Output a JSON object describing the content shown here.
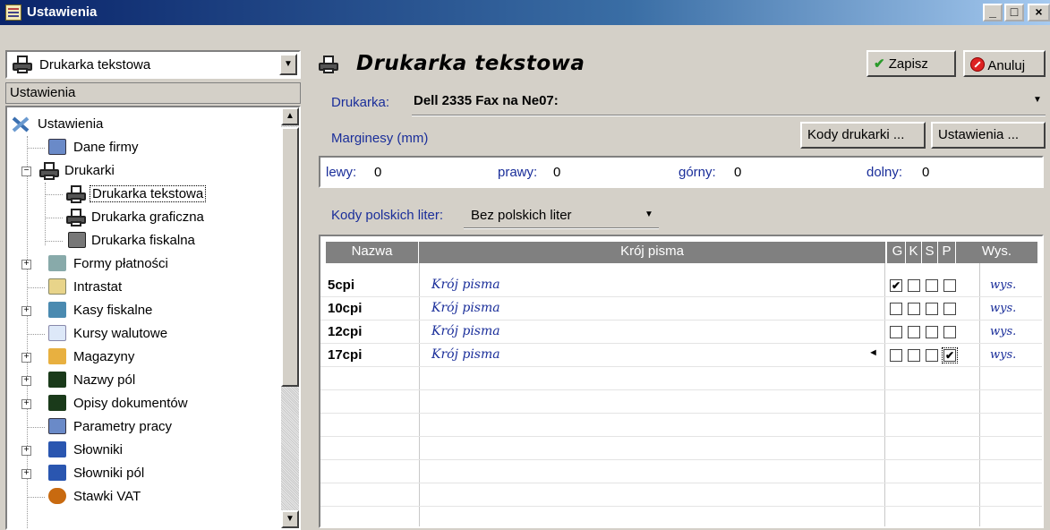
{
  "window": {
    "title": "Ustawienia",
    "min": "_",
    "max": "□",
    "close": "×"
  },
  "left": {
    "combo_value": "Drukarka tekstowa",
    "header": "Ustawienia",
    "tree": [
      {
        "label": "Ustawienia"
      },
      {
        "label": "Dane firmy"
      },
      {
        "label": "Drukarki"
      },
      {
        "label": "Drukarka tekstowa"
      },
      {
        "label": "Drukarka graficzna"
      },
      {
        "label": "Drukarka fiskalna"
      },
      {
        "label": "Formy płatności"
      },
      {
        "label": "Intrastat"
      },
      {
        "label": "Kasy fiskalne"
      },
      {
        "label": "Kursy walutowe"
      },
      {
        "label": "Magazyny"
      },
      {
        "label": "Nazwy pól"
      },
      {
        "label": "Opisy dokumentów"
      },
      {
        "label": "Parametry pracy"
      },
      {
        "label": "Słowniki"
      },
      {
        "label": "Słowniki pól"
      },
      {
        "label": "Stawki VAT"
      }
    ]
  },
  "right": {
    "title": "Drukarka tekstowa",
    "save_label": "Zapisz",
    "cancel_label": "Anuluj",
    "printer_label": "Drukarka:",
    "printer_value": "Dell 2335 Fax na Ne07:",
    "margins_label": "Marginesy (mm)",
    "printer_codes_btn": "Kody drukarki ...",
    "settings_btn": "Ustawienia ...",
    "margins": {
      "left_label": "lewy:",
      "left": "0",
      "right_label": "prawy:",
      "right": "0",
      "top_label": "górny:",
      "top": "0",
      "bottom_label": "dolny:",
      "bottom": "0"
    },
    "polish_codes_label": "Kody polskich liter:",
    "polish_codes_value": "Bez polskich liter",
    "grid": {
      "headers": {
        "name": "Nazwa",
        "font": "Krój pisma",
        "g": "G",
        "k": "K",
        "s": "S",
        "p": "P",
        "wys": "Wys."
      },
      "rows": [
        {
          "name": "5cpi",
          "font": "Krój pisma",
          "g": true,
          "k": false,
          "s": false,
          "p": false,
          "wys": "wys."
        },
        {
          "name": "10cpi",
          "font": "Krój pisma",
          "g": false,
          "k": false,
          "s": false,
          "p": false,
          "wys": "wys."
        },
        {
          "name": "12cpi",
          "font": "Krój pisma",
          "g": false,
          "k": false,
          "s": false,
          "p": false,
          "wys": "wys."
        },
        {
          "name": "17cpi",
          "font": "Krój pisma",
          "g": false,
          "k": false,
          "s": false,
          "p": true,
          "wys": "wys."
        }
      ]
    }
  }
}
